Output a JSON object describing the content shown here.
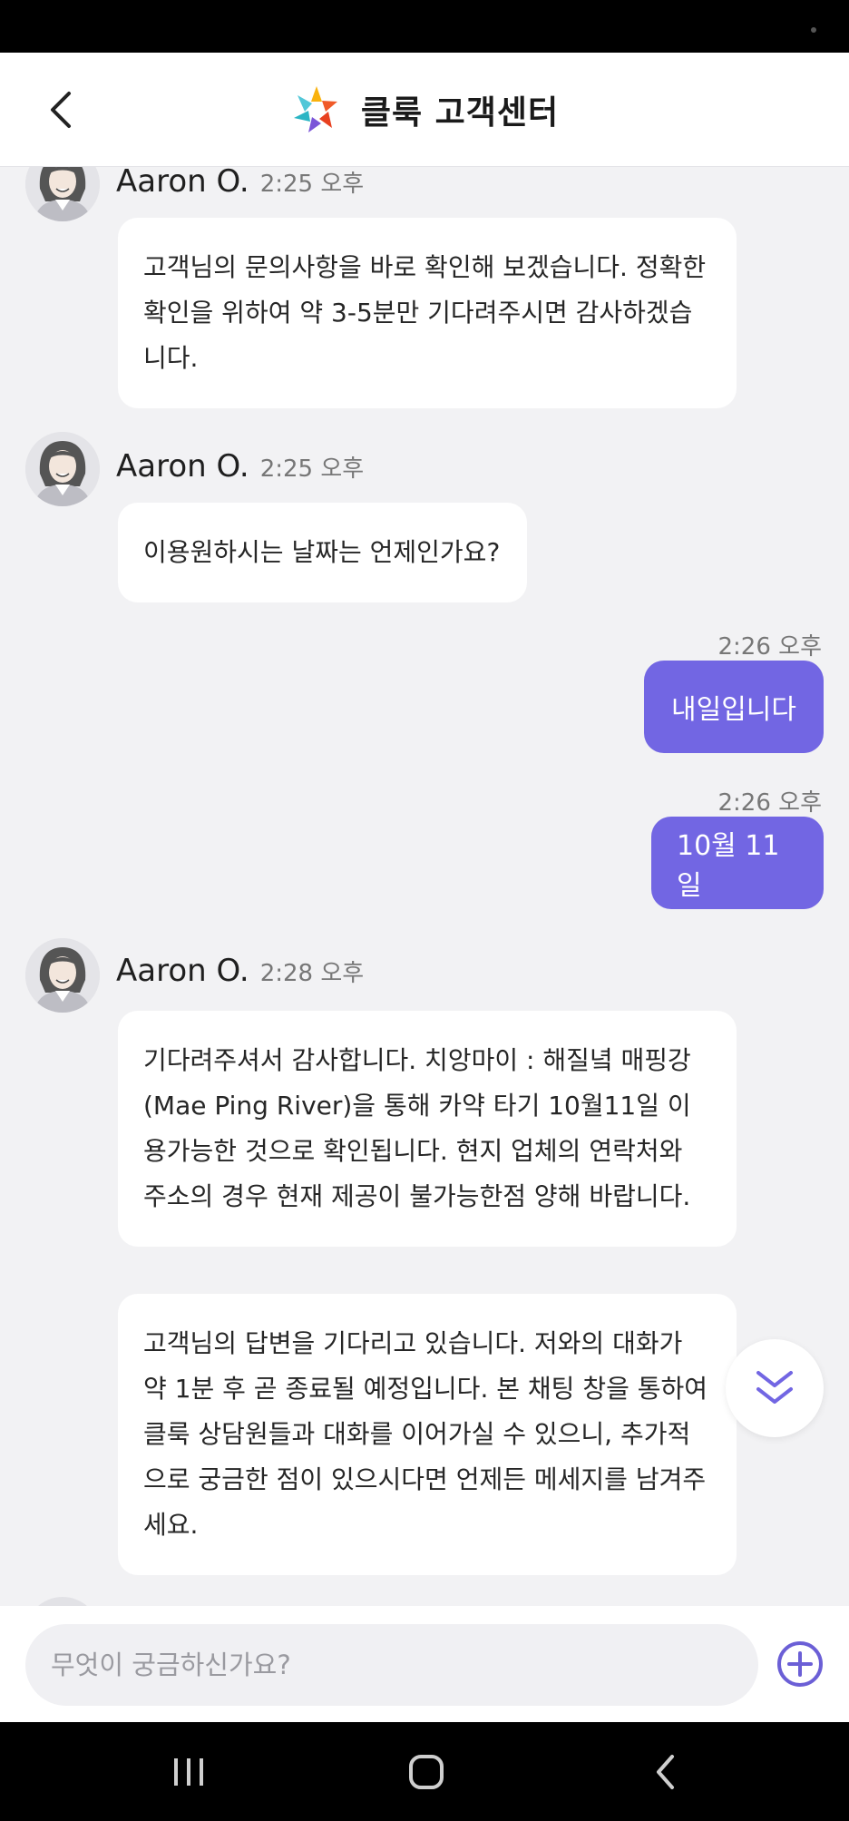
{
  "header": {
    "title": "클룩 고객센터",
    "logo_icon": "klook-logo-icon",
    "back_icon": "chevron-left-icon"
  },
  "messages": [
    {
      "type": "incoming",
      "sender": "Aaron O.",
      "time": "2:25 오후",
      "text": "고객님의 문의사항을 바로 확인해 보겠습니다. 정확한 확인을 위하여 약 3-5분만 기다려주시면 감사하겠습니다."
    },
    {
      "type": "incoming",
      "sender": "Aaron O.",
      "time": "2:25 오후",
      "text": "이용원하시는 날짜는 언제인가요?"
    },
    {
      "type": "outgoing",
      "time": "2:26 오후",
      "text": "내일입니다"
    },
    {
      "type": "outgoing",
      "time": "2:26 오후",
      "text": "10월 11일"
    },
    {
      "type": "incoming",
      "sender": "Aaron O.",
      "time": "2:28 오후",
      "text": "기다려주셔서 감사합니다. 치앙마이 : 해질녘 매핑강(Mae Ping River)을 통해 카약 타기 10월11일 이용가능한 것으로 확인됩니다. 현지 업체의 연락처와 주소의 경우 현재 제공이 불가능한점 양해 바랍니다."
    },
    {
      "type": "incoming-continued",
      "text": "고객님의 답변을 기다리고 있습니다. 저와의 대화가 약 1분 후 곧 종료될 예정입니다. 본 채팅 창을 통하여 클룩 상담원들과 대화를 이어가실 수 있으니, 추가적으로 궁금한 점이 있으시다면 언제든 메세지를 남겨주세요."
    }
  ],
  "input": {
    "placeholder": "무엇이 궁금하신가요?"
  },
  "colors": {
    "accent": "#7266e3",
    "background": "#f2f2f4",
    "bubble_in": "#ffffff"
  },
  "icons": {
    "scroll_down": "double-chevron-down-icon",
    "add": "plus-circle-icon",
    "nav_recents": "recents-icon",
    "nav_home": "home-icon",
    "nav_back": "back-icon"
  }
}
